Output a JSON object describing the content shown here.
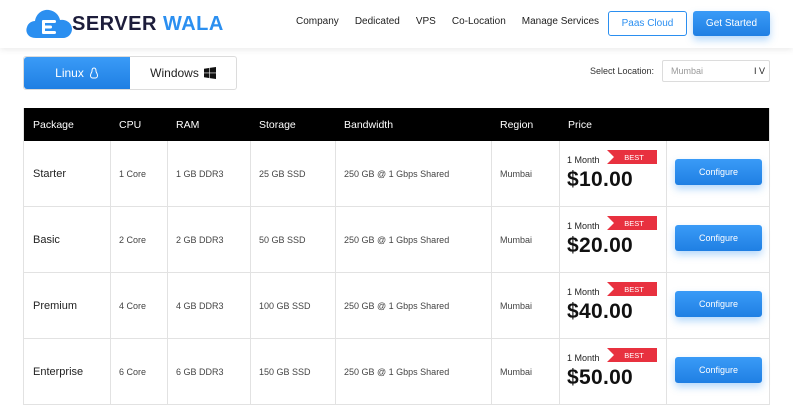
{
  "header": {
    "logo_text_1": "SERVER",
    "logo_text_2": "WALA",
    "nav": [
      "Company",
      "Dedicated",
      "VPS",
      "Co-Location",
      "Manage Services"
    ],
    "paas_label": "Paas Cloud",
    "started_label": "Get Started"
  },
  "os_tabs": [
    {
      "label": "Linux",
      "icon": "linux-icon",
      "active": true
    },
    {
      "label": "Windows",
      "icon": "windows-icon",
      "active": false
    }
  ],
  "location": {
    "label": "Select Location:",
    "selected": "Mumbai",
    "arrow": "I V"
  },
  "table": {
    "headers": [
      "Package",
      "CPU",
      "RAM",
      "Storage",
      "Bandwidth",
      "Region",
      "Price"
    ],
    "rows": [
      {
        "package": "Starter",
        "cpu": "1 Core",
        "ram": "1 GB DDR3",
        "storage": "25 GB SSD",
        "bandwidth": "250 GB @ 1 Gbps Shared",
        "region": "Mumbai",
        "period": "1 Month",
        "badge": "BEST",
        "price": "$10.00",
        "action": "Configure"
      },
      {
        "package": "Basic",
        "cpu": "2 Core",
        "ram": "2 GB DDR3",
        "storage": "50 GB SSD",
        "bandwidth": "250 GB @ 1 Gbps Shared",
        "region": "Mumbai",
        "period": "1 Month",
        "badge": "BEST",
        "price": "$20.00",
        "action": "Configure"
      },
      {
        "package": "Premium",
        "cpu": "4 Core",
        "ram": "4 GB DDR3",
        "storage": "100 GB SSD",
        "bandwidth": "250 GB @ 1 Gbps Shared",
        "region": "Mumbai",
        "period": "1 Month",
        "badge": "BEST",
        "price": "$40.00",
        "action": "Configure"
      },
      {
        "package": "Enterprise",
        "cpu": "6 Core",
        "ram": "6 GB DDR3",
        "storage": "150 GB SSD",
        "bandwidth": "250 GB @ 1 Gbps Shared",
        "region": "Mumbai",
        "period": "1 Month",
        "badge": "BEST",
        "price": "$50.00",
        "action": "Configure"
      }
    ]
  },
  "colors": {
    "accent": "#2b8ff0",
    "badge": "#e8313f",
    "header_bg": "#000000"
  }
}
